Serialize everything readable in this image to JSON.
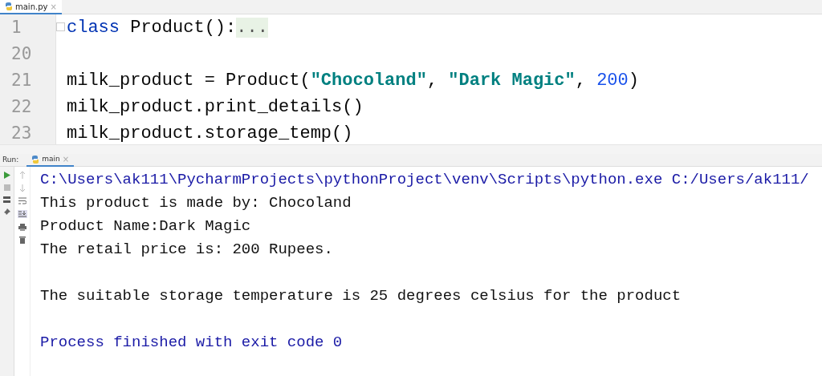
{
  "editor_tab": {
    "label": "main.py",
    "close": "×"
  },
  "code_lines": [
    {
      "number": "1",
      "folded": true,
      "tokens": [
        {
          "kind": "keyword",
          "text": "class"
        },
        {
          "kind": "plain",
          "text": " Product():"
        },
        {
          "kind": "fold",
          "text": "..."
        }
      ]
    },
    {
      "number": "20",
      "folded": false
    },
    {
      "number": "21",
      "folded": false,
      "tokens": [
        {
          "kind": "plain",
          "text": "milk_product = Product("
        },
        {
          "kind": "string",
          "text": "\"Chocoland\""
        },
        {
          "kind": "plain",
          "text": ", "
        },
        {
          "kind": "string",
          "text": "\"Dark Magic\""
        },
        {
          "kind": "plain",
          "text": ", "
        },
        {
          "kind": "number",
          "text": "200"
        },
        {
          "kind": "plain",
          "text": ")"
        }
      ]
    },
    {
      "number": "22",
      "folded": false,
      "tokens": [
        {
          "kind": "plain",
          "text": "milk_product.print_details()"
        }
      ]
    },
    {
      "number": "23",
      "folded": false,
      "tokens": [
        {
          "kind": "plain",
          "text": "milk_product.storage_temp()"
        }
      ]
    }
  ],
  "run_panel": {
    "label": "Run:",
    "tab": {
      "label": "main",
      "close": "×",
      "selected": true
    }
  },
  "console_lines": [
    {
      "kind": "command",
      "text": "C:\\Users\\ak111\\PycharmProjects\\pythonProject\\venv\\Scripts\\python.exe C:/Users/ak111/"
    },
    {
      "kind": "output",
      "text": "This product is made by: Chocoland"
    },
    {
      "kind": "output",
      "text": "Product Name:Dark Magic"
    },
    {
      "kind": "output",
      "text": "The retail price is: 200 Rupees."
    },
    {
      "kind": "blank"
    },
    {
      "kind": "output",
      "text": "The suitable storage temperature is 25 degrees celsius for the product"
    },
    {
      "kind": "blank"
    },
    {
      "kind": "exit",
      "text": "Process finished with exit code 0"
    }
  ]
}
